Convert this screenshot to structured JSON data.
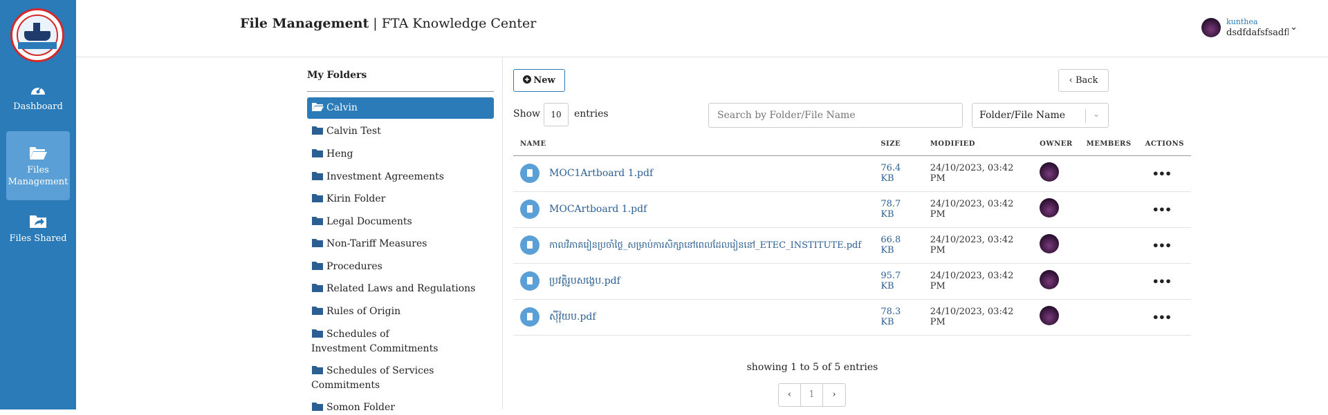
{
  "header": {
    "title_bold": "File Management",
    "title_sep": " | ",
    "title_rest": "FTA Knowledge Center"
  },
  "user": {
    "name": "kunthea",
    "id": "dsdfdafsfsadfl",
    "avatar_icon": "avatar"
  },
  "sidebar": {
    "logo_icon": "ministry-logo",
    "items": [
      {
        "label": "Dashboard",
        "icon": "gauge-icon",
        "active": false
      },
      {
        "label": "Files Management",
        "icon": "folder-open-icon",
        "active": true
      },
      {
        "label": "Files Shared",
        "icon": "folder-share-icon",
        "active": false
      }
    ]
  },
  "folders": {
    "heading": "My Folders",
    "items": [
      "Calvin",
      "Calvin Test",
      "Heng",
      "Investment Agreements",
      "Kirin Folder",
      "Legal Documents",
      "Non-Tariff Measures",
      "Procedures",
      "Related Laws and Regulations",
      "Rules of Origin",
      "Schedules of Investment Commitments",
      "Schedules of Services Commitments",
      "Somon Folder"
    ],
    "selected": "Calvin"
  },
  "toolbar": {
    "new_label": "New",
    "back_label": "Back"
  },
  "list_controls": {
    "show_label": "Show",
    "entries_value": "10",
    "entries_label": "entries",
    "search_placeholder": "Search by Folder/File Name",
    "filter_value": "Folder/File Name"
  },
  "table": {
    "headers": [
      "NAME",
      "SIZE",
      "MODIFIED",
      "OWNER",
      "MEMBERS",
      "ACTIONS"
    ],
    "rows": [
      {
        "name": "MOC1Artboard 1.pdf",
        "size": "76.4 KB",
        "modified": "24/10/2023, 03:42 PM"
      },
      {
        "name": "MOCArtboard 1.pdf",
        "size": "78.7 KB",
        "modified": "24/10/2023, 03:42 PM"
      },
      {
        "name": "កាលវិភាគរៀនប្រចាំថ្ងៃ_សម្រាប់ការសិក្សានៅពេលដែលរៀននៅ_ETEC_INSTITUTE.pdf",
        "size": "66.8 KB",
        "modified": "24/10/2023, 03:42 PM"
      },
      {
        "name": "ប្រវត្តិរូបសង្ខេប.pdf",
        "size": "95.7 KB",
        "modified": "24/10/2023, 03:42 PM"
      },
      {
        "name": "ស៊ីវ៉ុយប.pdf",
        "size": "78.3 KB",
        "modified": "24/10/2023, 03:42 PM"
      }
    ],
    "actions_glyph": "•••"
  },
  "pagination": {
    "info": "showing 1 to 5 of 5 entries",
    "prev": "‹",
    "page": "1",
    "next": "›"
  },
  "colors": {
    "sidebar": "#2a7bb8",
    "accent": "#2a7bb8",
    "link": "#2a5f94"
  }
}
